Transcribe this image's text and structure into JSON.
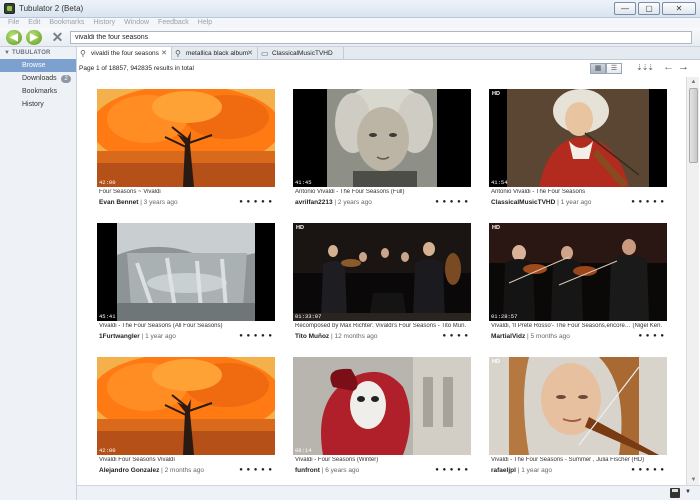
{
  "window": {
    "title": "Tubulator 2 (Beta)",
    "min_glyph": "—",
    "max_glyph": "▢",
    "close_glyph": "✕"
  },
  "menu": [
    "File",
    "Edit",
    "Bookmarks",
    "History",
    "Window",
    "Feedback",
    "Help"
  ],
  "toolbar": {
    "back_glyph": "◀",
    "forward_glyph": "▶",
    "stop_glyph": "✕",
    "search_value": "vivaldi the four seasons"
  },
  "sidebar": {
    "header": "TUBULATOR",
    "items": [
      {
        "label": "Browse",
        "active": true
      },
      {
        "label": "Downloads",
        "badge": "2"
      },
      {
        "label": "Bookmarks"
      },
      {
        "label": "History"
      }
    ]
  },
  "tabs": [
    {
      "label": "vivaldi the four seasons",
      "active": true
    },
    {
      "label": "metallica black album"
    },
    {
      "label": "ClassicalMusicTVHD"
    }
  ],
  "results": {
    "summary": "Page 1 of 18857, 942835 results in total"
  },
  "videos": [
    {
      "title": "Four Seasons ~ Vivaldi",
      "uploader": "Evan Bennet",
      "age": "| 3 years ago",
      "duration": "42:00",
      "hd": "",
      "rating": "● ● ● ● ●"
    },
    {
      "title": "Antonio Vivaldi - The Four Seasons (Full)",
      "uploader": "avrilfan2213",
      "age": "| 2 years ago",
      "duration": "41:45",
      "hd": "",
      "rating": "● ● ● ● ●"
    },
    {
      "title": "Antonio Vivaldi - The Four Seasons",
      "uploader": "ClassicalMusicTVHD",
      "age": "| 1 year ago",
      "duration": "41:54",
      "hd": "HD",
      "rating": "● ● ● ● ●"
    },
    {
      "title": "Vivaldi - The Four Seasons (All Four Seasons)",
      "uploader": "1Furtwangler",
      "age": "| 1 year ago",
      "duration": "45:41",
      "hd": "",
      "rating": "● ● ● ● ●"
    },
    {
      "title": "Recomposed by Max Richter: Vivaldi's Four Seasons - Tito Muñ…",
      "uploader": "Tito Muñoz",
      "age": "| 12 months ago",
      "duration": "01:33:07",
      "hd": "HD",
      "rating": "● ● ● ●"
    },
    {
      "title": "Vivaldi, 'Il Prete Rosso'- The Four Seasons,encore… (Nigel Ken…",
      "uploader": "MartialVidz",
      "age": "| 5 months ago",
      "duration": "01:28:57",
      "hd": "HD",
      "rating": "● ● ● ●"
    },
    {
      "title": "Vivaldi Four Seasons Vivaldi",
      "uploader": "Alejandro Gonzalez",
      "age": "| 2 months ago",
      "duration": "42:00",
      "hd": "",
      "rating": "● ● ● ● ●"
    },
    {
      "title": "Vivaldi - Four Seasons (Winter)",
      "uploader": "funfront",
      "age": "| 6 years ago",
      "duration": "08:14",
      "hd": "",
      "rating": "● ● ● ● ●"
    },
    {
      "title": "Vivaldi - The Four Seasons - Summer , Julia Fischer (HD)",
      "uploader": "rafaeljpl",
      "age": "| 1 year ago",
      "duration": "",
      "hd": "HD",
      "rating": "● ● ● ● ●"
    }
  ],
  "status": {
    "caret_glyph": "▼"
  },
  "colors": {
    "sidebar_active": "#7da1cf",
    "autumn_orange": "#ff7a12",
    "title_gradient": "#d9e4f1"
  }
}
